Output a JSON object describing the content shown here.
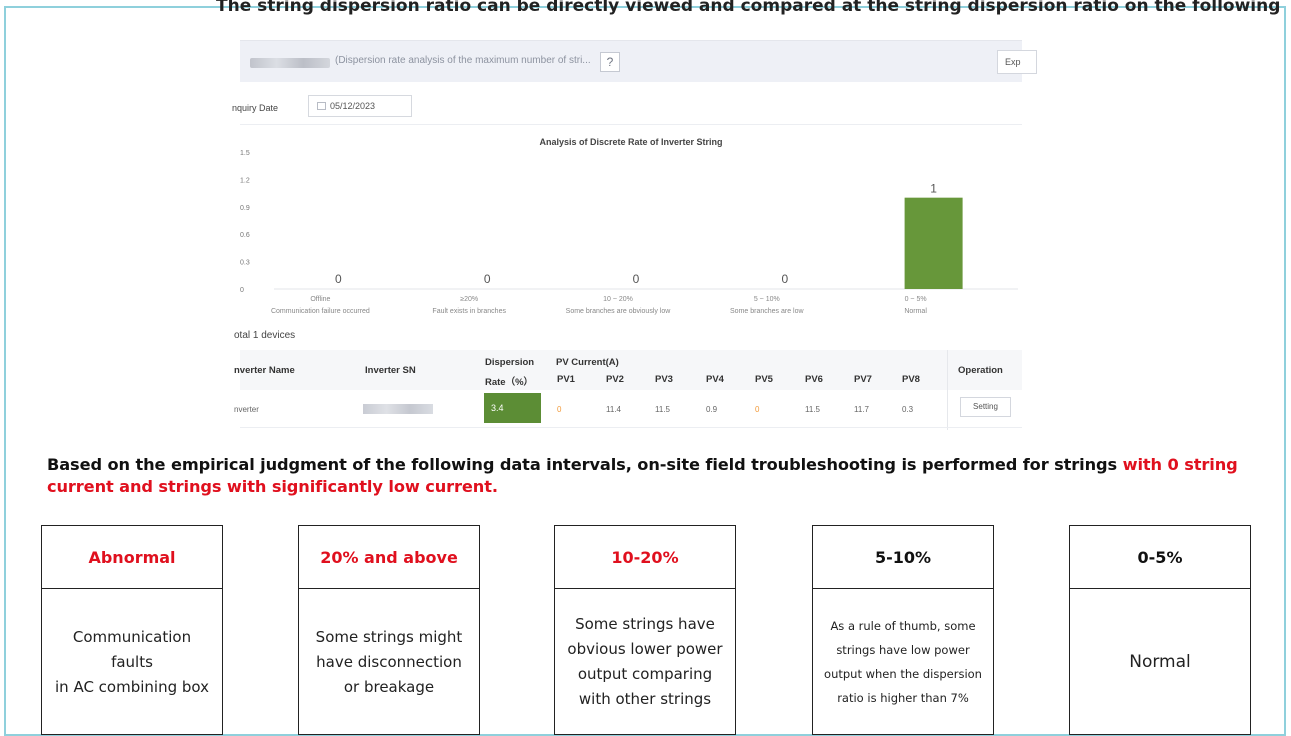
{
  "header": {
    "title_suffix": "(Dispersion rate analysis of the maximum number of stri...",
    "help_label": "?",
    "export_label": "Exp"
  },
  "filter": {
    "inquiry_label": "nquiry Date",
    "date_value": "05/12/2023"
  },
  "chart_data": {
    "type": "bar",
    "title": "Analysis of Discrete Rate of Inverter String",
    "categories": [
      "Offline",
      "≥20%",
      "10 ~ 20%",
      "5 ~ 10%",
      "0 ~ 5%"
    ],
    "category_descriptions": [
      "Communication failure occurred",
      "Fault exists in branches",
      "Some branches are obviously low",
      "Some branches are low",
      "Normal"
    ],
    "values": [
      0,
      0,
      0,
      0,
      1
    ],
    "value_labels": [
      "0",
      "0",
      "0",
      "0",
      "1"
    ],
    "ylim": [
      0,
      1.5
    ],
    "y_ticks": [
      "1.5",
      "1.2",
      "0.9",
      "0.6",
      "0.3",
      "0"
    ],
    "bar_color": "#67973a",
    "grid": false
  },
  "table": {
    "total_label": "otal 1 devices",
    "headers": {
      "inverter_name": "nverter Name",
      "inverter_sn": "Inverter SN",
      "dispersion_line1": "Dispersion",
      "dispersion_line2": "Rate（%）",
      "pv_current": "PV Current(A)",
      "operation": "Operation"
    },
    "pv_labels": [
      "PV1",
      "PV2",
      "PV3",
      "PV4",
      "PV5",
      "PV6",
      "PV7",
      "PV8"
    ],
    "row": {
      "inverter_name": "nverter",
      "dispersion_rate": "3.4",
      "pv_values": [
        "0",
        "11.4",
        "11.5",
        "0.9",
        "0",
        "11.5",
        "11.7",
        "0.3"
      ],
      "setting_label": "Setting"
    },
    "warn_color": "#f29a3a",
    "highlight_color": "#5c8d35"
  },
  "top_cut_text": "The string dispersion ratio can be directly viewed and compared at the string dispersion ratio on the following",
  "statement": {
    "part1": "Based on the empirical judgment of the following data intervals, on-site field troubleshooting is performed for strings ",
    "highlight": "with 0 string current and strings with significantly low current."
  },
  "boxes": [
    {
      "title": "Abnormal",
      "title_red": true,
      "text": "Communication faults\nin AC combining box"
    },
    {
      "title": "20% and above",
      "title_red": true,
      "text": "Some strings might\nhave disconnection\nor breakage"
    },
    {
      "title": "10-20%",
      "title_red": true,
      "text": "Some strings have\nobvious lower power\noutput comparing\nwith other strings"
    },
    {
      "title": "5-10%",
      "title_red": false,
      "text": "As a rule of thumb, some\nstrings have low power\noutput when the dispersion\nratio is higher than 7%"
    },
    {
      "title": "0-5%",
      "title_red": false,
      "text": "Normal"
    }
  ],
  "colors": {
    "accent_red": "#e0101e",
    "frame_border": "#8fd0dc"
  }
}
